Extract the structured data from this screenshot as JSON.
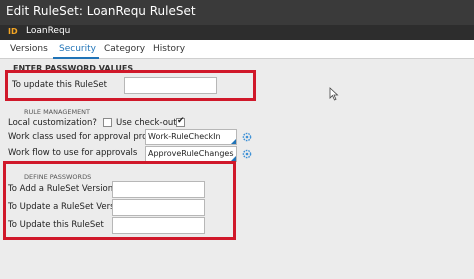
{
  "window": {
    "title": "Edit RuleSet: LoanRequ RuleSet",
    "id_badge": "ID",
    "id_name": "LoanRequ"
  },
  "tabs": [
    {
      "label": "Versions",
      "active": false
    },
    {
      "label": "Security",
      "active": true
    },
    {
      "label": "Category",
      "active": false
    },
    {
      "label": "History",
      "active": false
    }
  ],
  "enter_passwords": {
    "heading": "ENTER PASSWORD VALUES",
    "update_label": "To update this RuleSet",
    "update_value": ""
  },
  "rule_management": {
    "heading": "RULE MANAGEMENT",
    "local_customization_label": "Local customization?",
    "local_customization_checked": false,
    "use_checkout_label": "Use check-out?",
    "use_checkout_checked": true,
    "work_class_label": "Work class used for approval process",
    "work_class_value": "Work-RuleCheckIn",
    "work_flow_label": "Work flow to use for approvals",
    "work_flow_value": "ApproveRuleChanges"
  },
  "define_passwords": {
    "heading": "DEFINE PASSWORDS",
    "add_version_label": "To Add a RuleSet Version",
    "add_version_value": "",
    "update_version_label": "To Update a RuleSet Version",
    "update_version_value": "",
    "update_ruleset_label": "To Update this RuleSet",
    "update_ruleset_value": ""
  },
  "colors": {
    "title_bar": "#3a3a3a",
    "accent": "#1f73b7",
    "highlight_box": "#d0182a"
  }
}
